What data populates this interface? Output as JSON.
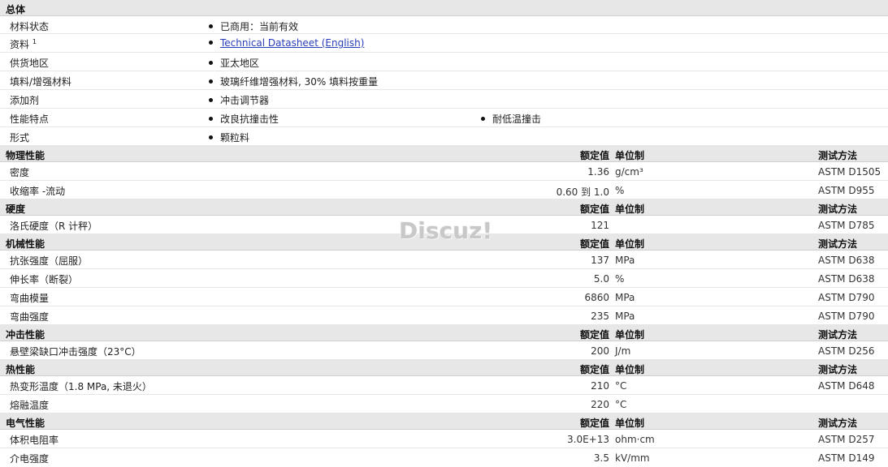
{
  "general": {
    "title": "总体",
    "rows": [
      {
        "label": "材料状态",
        "v1": "已商用：当前有效"
      },
      {
        "label": "资料",
        "sup": "1",
        "v1": "Technical Datasheet (English)"
      },
      {
        "label": "供货地区",
        "v1": "亚太地区"
      },
      {
        "label": "填料/增强材料",
        "v1": "玻璃纤维增强材料, 30% 填料按重量"
      },
      {
        "label": "添加剂",
        "v1": "冲击调节器"
      },
      {
        "label": "性能特点",
        "v1": "改良抗撞击性",
        "v2": "耐低温撞击"
      },
      {
        "label": "形式",
        "v1": "颗粒料"
      }
    ]
  },
  "col_headers": {
    "value": "额定值",
    "unit": "单位制",
    "test": "测试方法"
  },
  "sections": [
    {
      "title": "物理性能",
      "rows": [
        {
          "label": "密度",
          "value": "1.36",
          "unit": "g/cm³",
          "test": "ASTM D1505"
        },
        {
          "label": "收缩率 -流动",
          "value": "0.60 到  1.0",
          "unit": "%",
          "test": "ASTM D955"
        }
      ]
    },
    {
      "title": "硬度",
      "rows": [
        {
          "label": "洛氏硬度（R 计秤）",
          "value": "121",
          "unit": "",
          "test": "ASTM D785"
        }
      ]
    },
    {
      "title": "机械性能",
      "rows": [
        {
          "label": "抗张强度（屈服）",
          "value": "137",
          "unit": "MPa",
          "test": "ASTM D638"
        },
        {
          "label": "伸长率（断裂）",
          "value": "5.0",
          "unit": "%",
          "test": "ASTM D638"
        },
        {
          "label": "弯曲模量",
          "value": "6860",
          "unit": "MPa",
          "test": "ASTM D790"
        },
        {
          "label": "弯曲强度",
          "value": "235",
          "unit": "MPa",
          "test": "ASTM D790"
        }
      ]
    },
    {
      "title": "冲击性能",
      "rows": [
        {
          "label": "悬壁梁缺口冲击强度（23°C）",
          "value": "200",
          "unit": "J/m",
          "test": "ASTM D256"
        }
      ]
    },
    {
      "title": "热性能",
      "rows": [
        {
          "label": "热变形温度（1.8 MPa, 未退火）",
          "value": "210",
          "unit": "°C",
          "test": "ASTM D648"
        },
        {
          "label": "熔融温度",
          "value": "220",
          "unit": "°C",
          "test": ""
        }
      ]
    },
    {
      "title": "电气性能",
      "rows": [
        {
          "label": "体积电阻率",
          "value": "3.0E+13",
          "unit": "ohm·cm",
          "test": "ASTM D257"
        },
        {
          "label": "介电强度",
          "value": "3.5",
          "unit": "kV/mm",
          "test": "ASTM D149"
        }
      ]
    }
  ],
  "watermark": "Discuz!"
}
